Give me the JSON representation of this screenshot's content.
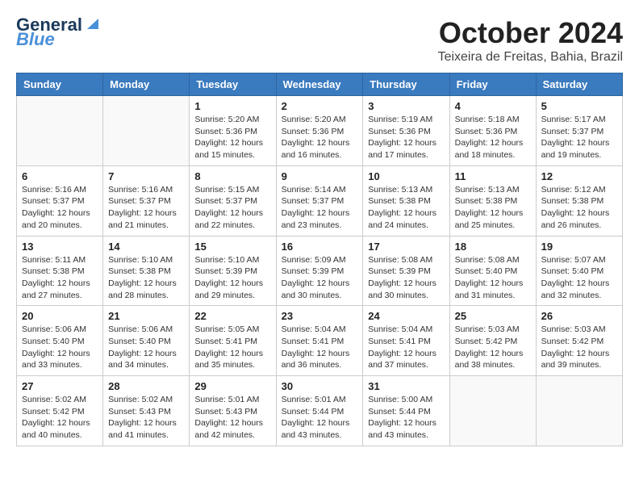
{
  "header": {
    "logo_line1": "General",
    "logo_line2": "Blue",
    "month": "October 2024",
    "location": "Teixeira de Freitas, Bahia, Brazil"
  },
  "weekdays": [
    "Sunday",
    "Monday",
    "Tuesday",
    "Wednesday",
    "Thursday",
    "Friday",
    "Saturday"
  ],
  "weeks": [
    [
      {
        "day": "",
        "sunrise": "",
        "sunset": "",
        "daylight": ""
      },
      {
        "day": "",
        "sunrise": "",
        "sunset": "",
        "daylight": ""
      },
      {
        "day": "1",
        "sunrise": "Sunrise: 5:20 AM",
        "sunset": "Sunset: 5:36 PM",
        "daylight": "Daylight: 12 hours and 15 minutes."
      },
      {
        "day": "2",
        "sunrise": "Sunrise: 5:20 AM",
        "sunset": "Sunset: 5:36 PM",
        "daylight": "Daylight: 12 hours and 16 minutes."
      },
      {
        "day": "3",
        "sunrise": "Sunrise: 5:19 AM",
        "sunset": "Sunset: 5:36 PM",
        "daylight": "Daylight: 12 hours and 17 minutes."
      },
      {
        "day": "4",
        "sunrise": "Sunrise: 5:18 AM",
        "sunset": "Sunset: 5:36 PM",
        "daylight": "Daylight: 12 hours and 18 minutes."
      },
      {
        "day": "5",
        "sunrise": "Sunrise: 5:17 AM",
        "sunset": "Sunset: 5:37 PM",
        "daylight": "Daylight: 12 hours and 19 minutes."
      }
    ],
    [
      {
        "day": "6",
        "sunrise": "Sunrise: 5:16 AM",
        "sunset": "Sunset: 5:37 PM",
        "daylight": "Daylight: 12 hours and 20 minutes."
      },
      {
        "day": "7",
        "sunrise": "Sunrise: 5:16 AM",
        "sunset": "Sunset: 5:37 PM",
        "daylight": "Daylight: 12 hours and 21 minutes."
      },
      {
        "day": "8",
        "sunrise": "Sunrise: 5:15 AM",
        "sunset": "Sunset: 5:37 PM",
        "daylight": "Daylight: 12 hours and 22 minutes."
      },
      {
        "day": "9",
        "sunrise": "Sunrise: 5:14 AM",
        "sunset": "Sunset: 5:37 PM",
        "daylight": "Daylight: 12 hours and 23 minutes."
      },
      {
        "day": "10",
        "sunrise": "Sunrise: 5:13 AM",
        "sunset": "Sunset: 5:38 PM",
        "daylight": "Daylight: 12 hours and 24 minutes."
      },
      {
        "day": "11",
        "sunrise": "Sunrise: 5:13 AM",
        "sunset": "Sunset: 5:38 PM",
        "daylight": "Daylight: 12 hours and 25 minutes."
      },
      {
        "day": "12",
        "sunrise": "Sunrise: 5:12 AM",
        "sunset": "Sunset: 5:38 PM",
        "daylight": "Daylight: 12 hours and 26 minutes."
      }
    ],
    [
      {
        "day": "13",
        "sunrise": "Sunrise: 5:11 AM",
        "sunset": "Sunset: 5:38 PM",
        "daylight": "Daylight: 12 hours and 27 minutes."
      },
      {
        "day": "14",
        "sunrise": "Sunrise: 5:10 AM",
        "sunset": "Sunset: 5:38 PM",
        "daylight": "Daylight: 12 hours and 28 minutes."
      },
      {
        "day": "15",
        "sunrise": "Sunrise: 5:10 AM",
        "sunset": "Sunset: 5:39 PM",
        "daylight": "Daylight: 12 hours and 29 minutes."
      },
      {
        "day": "16",
        "sunrise": "Sunrise: 5:09 AM",
        "sunset": "Sunset: 5:39 PM",
        "daylight": "Daylight: 12 hours and 30 minutes."
      },
      {
        "day": "17",
        "sunrise": "Sunrise: 5:08 AM",
        "sunset": "Sunset: 5:39 PM",
        "daylight": "Daylight: 12 hours and 30 minutes."
      },
      {
        "day": "18",
        "sunrise": "Sunrise: 5:08 AM",
        "sunset": "Sunset: 5:40 PM",
        "daylight": "Daylight: 12 hours and 31 minutes."
      },
      {
        "day": "19",
        "sunrise": "Sunrise: 5:07 AM",
        "sunset": "Sunset: 5:40 PM",
        "daylight": "Daylight: 12 hours and 32 minutes."
      }
    ],
    [
      {
        "day": "20",
        "sunrise": "Sunrise: 5:06 AM",
        "sunset": "Sunset: 5:40 PM",
        "daylight": "Daylight: 12 hours and 33 minutes."
      },
      {
        "day": "21",
        "sunrise": "Sunrise: 5:06 AM",
        "sunset": "Sunset: 5:40 PM",
        "daylight": "Daylight: 12 hours and 34 minutes."
      },
      {
        "day": "22",
        "sunrise": "Sunrise: 5:05 AM",
        "sunset": "Sunset: 5:41 PM",
        "daylight": "Daylight: 12 hours and 35 minutes."
      },
      {
        "day": "23",
        "sunrise": "Sunrise: 5:04 AM",
        "sunset": "Sunset: 5:41 PM",
        "daylight": "Daylight: 12 hours and 36 minutes."
      },
      {
        "day": "24",
        "sunrise": "Sunrise: 5:04 AM",
        "sunset": "Sunset: 5:41 PM",
        "daylight": "Daylight: 12 hours and 37 minutes."
      },
      {
        "day": "25",
        "sunrise": "Sunrise: 5:03 AM",
        "sunset": "Sunset: 5:42 PM",
        "daylight": "Daylight: 12 hours and 38 minutes."
      },
      {
        "day": "26",
        "sunrise": "Sunrise: 5:03 AM",
        "sunset": "Sunset: 5:42 PM",
        "daylight": "Daylight: 12 hours and 39 minutes."
      }
    ],
    [
      {
        "day": "27",
        "sunrise": "Sunrise: 5:02 AM",
        "sunset": "Sunset: 5:42 PM",
        "daylight": "Daylight: 12 hours and 40 minutes."
      },
      {
        "day": "28",
        "sunrise": "Sunrise: 5:02 AM",
        "sunset": "Sunset: 5:43 PM",
        "daylight": "Daylight: 12 hours and 41 minutes."
      },
      {
        "day": "29",
        "sunrise": "Sunrise: 5:01 AM",
        "sunset": "Sunset: 5:43 PM",
        "daylight": "Daylight: 12 hours and 42 minutes."
      },
      {
        "day": "30",
        "sunrise": "Sunrise: 5:01 AM",
        "sunset": "Sunset: 5:44 PM",
        "daylight": "Daylight: 12 hours and 43 minutes."
      },
      {
        "day": "31",
        "sunrise": "Sunrise: 5:00 AM",
        "sunset": "Sunset: 5:44 PM",
        "daylight": "Daylight: 12 hours and 43 minutes."
      },
      {
        "day": "",
        "sunrise": "",
        "sunset": "",
        "daylight": ""
      },
      {
        "day": "",
        "sunrise": "",
        "sunset": "",
        "daylight": ""
      }
    ]
  ]
}
